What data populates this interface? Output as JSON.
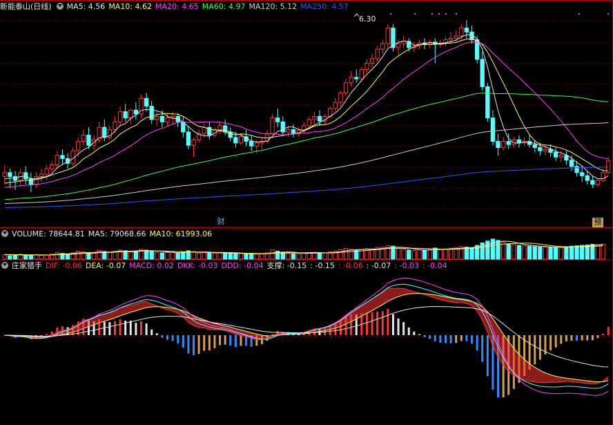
{
  "main_panel": {
    "stock_name": "新能泰山",
    "period": "(日线)",
    "ma_labels": [
      {
        "text": "MA5: 4.56",
        "color": "#e6e6e6"
      },
      {
        "text": "MA10: 4.62",
        "color": "#ffff55"
      },
      {
        "text": "MA20: 4.65",
        "color": "#ff44ff"
      },
      {
        "text": "MA60: 4.97",
        "color": "#44ff44"
      },
      {
        "text": "MA120: 5.12",
        "color": "#cfcfcf"
      },
      {
        "text": "MA250: 4.57",
        "color": "#3355ff"
      }
    ],
    "high_label": "6.30",
    "marker_cai": "财",
    "marker_yu": "预"
  },
  "volume_panel": {
    "labels": [
      {
        "text": "VOLUME: 78644.81",
        "color": "#e6e6e6"
      },
      {
        "text": "MA5: 79068.66",
        "color": "#e6e6e6"
      },
      {
        "text": "MA10: 61993.06",
        "color": "#ffff55"
      }
    ]
  },
  "indicator_panel": {
    "name": "庄家猎手",
    "labels": [
      {
        "text": "DIF: -0.06",
        "color": "#ff3333"
      },
      {
        "text": "DEA: -0.07",
        "color": "#ffff55"
      },
      {
        "text": "MACD: 0.02",
        "color": "#ff44ff"
      },
      {
        "text": "DKK: -0.03",
        "color": "#ff44ff"
      },
      {
        "text": "DDD: -0.04",
        "color": "#ff44ff"
      },
      {
        "text": "支撑: -0.15",
        "color": "#e6e6e6"
      },
      {
        "text": ": -0.15",
        "color": "#e6e6e6"
      },
      {
        "text": ": -0.06",
        "color": "#ff3333"
      },
      {
        "text": ": -0.07",
        "color": "#e6e6e6"
      },
      {
        "text": ": -0.03",
        "color": "#ff44ff"
      },
      {
        "text": ": -0.04",
        "color": "#ff44ff"
      }
    ]
  },
  "colors": {
    "up": "#ff3b3b",
    "down": "#54ffff",
    "grid": "#7a0000",
    "divider": "#b00000"
  },
  "chart_data": [
    {
      "type": "candlestick",
      "title": "新能泰山 (日线)",
      "x_count": 148,
      "ylim": [
        3.85,
        6.45
      ],
      "ohlc": [
        [
          4.35,
          4.5,
          4.4,
          4.25
        ],
        [
          4.4,
          4.45,
          4.35,
          4.2
        ],
        [
          4.35,
          4.42,
          4.3,
          4.18
        ],
        [
          4.3,
          4.45,
          4.4,
          4.22
        ],
        [
          4.4,
          4.48,
          4.32,
          4.25
        ],
        [
          4.32,
          4.4,
          4.25,
          4.15
        ],
        [
          4.25,
          4.4,
          4.35,
          4.2
        ],
        [
          4.35,
          4.45,
          4.38,
          4.28
        ],
        [
          4.38,
          4.5,
          4.45,
          4.3
        ],
        [
          4.45,
          4.55,
          4.5,
          4.38
        ],
        [
          4.5,
          4.68,
          4.62,
          4.45
        ],
        [
          4.62,
          4.7,
          4.58,
          4.5
        ],
        [
          4.58,
          4.65,
          4.52,
          4.45
        ],
        [
          4.52,
          4.72,
          4.68,
          4.48
        ],
        [
          4.68,
          4.85,
          4.8,
          4.6
        ],
        [
          4.8,
          4.95,
          4.88,
          4.75
        ],
        [
          4.88,
          4.98,
          4.75,
          4.7
        ],
        [
          4.75,
          4.88,
          4.82,
          4.68
        ],
        [
          4.82,
          5.05,
          4.98,
          4.78
        ],
        [
          4.98,
          5.08,
          4.85,
          4.8
        ],
        [
          4.85,
          5.0,
          4.95,
          4.82
        ],
        [
          4.95,
          5.12,
          5.05,
          4.9
        ],
        [
          5.05,
          5.25,
          5.18,
          5.0
        ],
        [
          5.18,
          5.28,
          5.1,
          5.05
        ],
        [
          5.1,
          5.22,
          5.2,
          5.02
        ],
        [
          5.2,
          5.3,
          5.15,
          5.08
        ],
        [
          5.15,
          5.4,
          5.35,
          5.1
        ],
        [
          5.35,
          5.42,
          5.25,
          5.18
        ],
        [
          5.25,
          5.32,
          5.08,
          5.02
        ],
        [
          5.08,
          5.18,
          5.12,
          5.0
        ],
        [
          5.12,
          5.2,
          5.05,
          4.98
        ],
        [
          5.05,
          5.15,
          5.1,
          5.0
        ],
        [
          5.1,
          5.18,
          5.12,
          5.02
        ],
        [
          5.12,
          5.16,
          5.05,
          4.98
        ],
        [
          5.05,
          5.12,
          4.92,
          4.85
        ],
        [
          4.92,
          5.0,
          4.75,
          4.7
        ],
        [
          4.75,
          4.85,
          4.82,
          4.6
        ],
        [
          4.82,
          4.95,
          4.9,
          4.78
        ],
        [
          4.9,
          5.02,
          4.98,
          4.85
        ],
        [
          4.98,
          5.05,
          4.88,
          4.82
        ],
        [
          4.88,
          4.98,
          4.95,
          4.85
        ],
        [
          4.95,
          5.05,
          5.0,
          4.9
        ],
        [
          5.0,
          5.08,
          4.92,
          4.88
        ],
        [
          4.92,
          4.98,
          4.85,
          4.8
        ],
        [
          4.85,
          4.92,
          4.78,
          4.72
        ],
        [
          4.78,
          4.9,
          4.86,
          4.75
        ],
        [
          4.86,
          4.95,
          4.8,
          4.74
        ],
        [
          4.8,
          4.88,
          4.74,
          4.68
        ],
        [
          4.74,
          4.82,
          4.78,
          4.65
        ],
        [
          4.78,
          4.85,
          4.8,
          4.7
        ],
        [
          4.8,
          4.95,
          4.9,
          4.78
        ],
        [
          4.9,
          5.15,
          5.1,
          4.88
        ],
        [
          5.1,
          5.22,
          5.05,
          4.98
        ],
        [
          5.05,
          5.12,
          4.92,
          4.88
        ],
        [
          4.92,
          5.0,
          4.95,
          4.86
        ],
        [
          4.95,
          5.02,
          4.9,
          4.85
        ],
        [
          4.9,
          4.98,
          4.94,
          4.86
        ],
        [
          4.94,
          5.05,
          5.0,
          4.9
        ],
        [
          5.0,
          5.12,
          5.08,
          4.95
        ],
        [
          5.08,
          5.18,
          5.12,
          5.02
        ],
        [
          5.12,
          5.2,
          5.06,
          5.0
        ],
        [
          5.06,
          5.15,
          5.12,
          5.02
        ],
        [
          5.12,
          5.25,
          5.22,
          5.1
        ],
        [
          5.22,
          5.35,
          5.3,
          5.18
        ],
        [
          5.3,
          5.45,
          5.42,
          5.25
        ],
        [
          5.42,
          5.6,
          5.55,
          5.38
        ],
        [
          5.55,
          5.7,
          5.62,
          5.5
        ],
        [
          5.62,
          5.72,
          5.6,
          5.55
        ],
        [
          5.6,
          5.75,
          5.72,
          5.56
        ],
        [
          5.72,
          5.85,
          5.8,
          5.68
        ],
        [
          5.8,
          5.92,
          5.86,
          5.75
        ],
        [
          5.86,
          6.02,
          5.98,
          5.82
        ],
        [
          5.98,
          6.1,
          6.05,
          5.92
        ],
        [
          6.05,
          6.3,
          6.25,
          6.0
        ],
        [
          6.25,
          6.3,
          6.0,
          5.95
        ],
        [
          6.0,
          6.1,
          6.05,
          5.9
        ],
        [
          6.05,
          6.15,
          6.08,
          6.0
        ],
        [
          6.08,
          6.12,
          6.0,
          5.95
        ],
        [
          6.0,
          6.08,
          6.02,
          5.94
        ],
        [
          6.02,
          6.1,
          6.06,
          5.98
        ],
        [
          6.06,
          6.12,
          6.04,
          5.98
        ],
        [
          6.04,
          6.1,
          6.07,
          6.0
        ],
        [
          6.07,
          6.12,
          6.04,
          5.8
        ],
        [
          6.04,
          6.1,
          6.06,
          6.0
        ],
        [
          6.06,
          6.14,
          6.1,
          6.02
        ],
        [
          6.1,
          6.2,
          6.12,
          6.05
        ],
        [
          6.12,
          6.22,
          6.15,
          6.08
        ],
        [
          6.15,
          6.3,
          6.25,
          6.1
        ],
        [
          6.25,
          6.35,
          6.2,
          6.12
        ],
        [
          6.2,
          6.28,
          6.1,
          6.05
        ],
        [
          6.1,
          6.15,
          5.85,
          5.8
        ],
        [
          5.85,
          5.95,
          5.5,
          5.45
        ],
        [
          5.5,
          5.55,
          5.1,
          5.05
        ],
        [
          5.1,
          5.2,
          4.8,
          4.75
        ],
        [
          4.8,
          4.9,
          4.72,
          4.62
        ],
        [
          4.72,
          4.85,
          4.8,
          4.68
        ],
        [
          4.8,
          4.9,
          4.76,
          4.7
        ],
        [
          4.76,
          4.86,
          4.82,
          4.72
        ],
        [
          4.82,
          4.88,
          4.78,
          4.72
        ],
        [
          4.78,
          4.85,
          4.8,
          4.74
        ],
        [
          4.8,
          4.88,
          4.76,
          4.72
        ],
        [
          4.76,
          4.82,
          4.72,
          4.66
        ],
        [
          4.72,
          4.78,
          4.68,
          4.62
        ],
        [
          4.68,
          4.75,
          4.7,
          4.62
        ],
        [
          4.7,
          4.76,
          4.66,
          4.6
        ],
        [
          4.66,
          4.72,
          4.6,
          4.55
        ],
        [
          4.6,
          4.68,
          4.62,
          4.54
        ],
        [
          4.62,
          4.68,
          4.56,
          4.5
        ],
        [
          4.56,
          4.62,
          4.48,
          4.42
        ],
        [
          4.48,
          4.55,
          4.4,
          4.35
        ],
        [
          4.4,
          4.48,
          4.36,
          4.28
        ],
        [
          4.36,
          4.42,
          4.3,
          4.25
        ],
        [
          4.3,
          4.36,
          4.25,
          4.2
        ],
        [
          4.25,
          4.32,
          4.3,
          4.22
        ],
        [
          4.3,
          4.45,
          4.4,
          4.28
        ],
        [
          4.4,
          4.6,
          4.55,
          4.38
        ]
      ],
      "ma_values_last": {
        "MA5": 4.56,
        "MA10": 4.62,
        "MA20": 4.65,
        "MA60": 4.97,
        "MA120": 5.12,
        "MA250": 4.57
      }
    },
    {
      "type": "bar",
      "title": "VOLUME",
      "volume": [
        22000,
        18000,
        20000,
        26000,
        21000,
        19000,
        24000,
        20000,
        23000,
        27000,
        35000,
        30000,
        26000,
        33000,
        42000,
        38000,
        34000,
        31000,
        45000,
        40000,
        36000,
        41000,
        48000,
        44000,
        39000,
        43000,
        52000,
        47000,
        40000,
        35000,
        33000,
        34000,
        36000,
        31000,
        38000,
        44000,
        40000,
        32000,
        35000,
        33000,
        30000,
        34000,
        31000,
        29000,
        28000,
        30000,
        27000,
        29000,
        26000,
        28000,
        33000,
        48000,
        42000,
        36000,
        30000,
        28000,
        29000,
        31000,
        34000,
        35000,
        31000,
        33000,
        38000,
        42000,
        50000,
        56000,
        52000,
        47000,
        50000,
        55000,
        54000,
        60000,
        62000,
        70000,
        68000,
        55000,
        52000,
        48000,
        46000,
        49000,
        47000,
        50000,
        58000,
        52000,
        54000,
        57000,
        59000,
        66000,
        63000,
        60000,
        72000,
        85000,
        95000,
        105000,
        98000,
        88000,
        80000,
        76000,
        72000,
        70000,
        68000,
        66000,
        64000,
        63000,
        62000,
        60000,
        61000,
        65000,
        68000,
        70000,
        72000,
        74000,
        78000,
        76000,
        78644
      ],
      "ma5_last": 79068.66,
      "ma10_last": 61993.06
    },
    {
      "type": "line",
      "title": "庄家猎手",
      "series": [
        {
          "name": "DIF",
          "last": -0.06
        },
        {
          "name": "DEA",
          "last": -0.07
        },
        {
          "name": "MACD",
          "last": 0.02
        },
        {
          "name": "DKK",
          "last": -0.03
        },
        {
          "name": "DDD",
          "last": -0.04
        },
        {
          "name": "支撑",
          "last": -0.15
        }
      ]
    }
  ]
}
